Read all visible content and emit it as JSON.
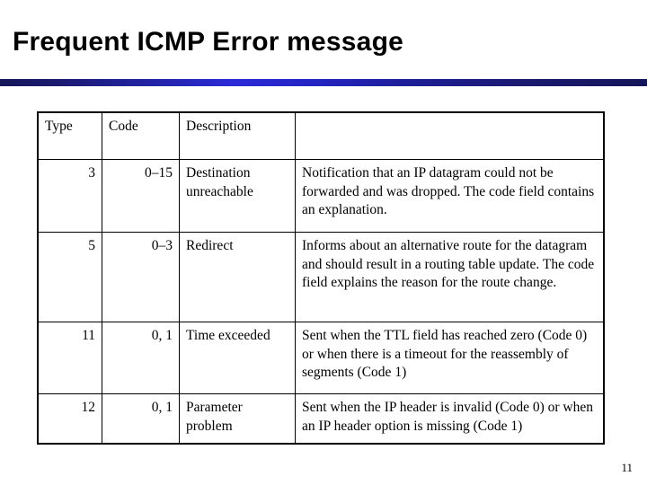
{
  "slide": {
    "title": "Frequent ICMP Error message",
    "page_number": "11",
    "accent_color": "#2222a0"
  },
  "table": {
    "headers": {
      "type": "Type",
      "code": "Code",
      "description": "Description",
      "detail": ""
    },
    "rows": [
      {
        "type": "3",
        "code": "0–15",
        "description": "Destination unreachable",
        "detail": "Notification that an IP datagram could not be forwarded and was dropped. The code field contains an explanation."
      },
      {
        "type": "5",
        "code": "0–3",
        "description": "Redirect",
        "detail": "Informs about an alternative route for the datagram and should result in a routing table update. The code field explains the reason for the route change."
      },
      {
        "type": "11",
        "code": "0, 1",
        "description": "Time exceeded",
        "detail": "Sent when the TTL field has reached zero (Code 0) or when there is a timeout for the reassembly of segments (Code 1)"
      },
      {
        "type": "12",
        "code": "0, 1",
        "description": "Parameter problem",
        "detail": "Sent when the IP header is invalid (Code 0) or when an IP header option is missing (Code 1)"
      }
    ]
  }
}
